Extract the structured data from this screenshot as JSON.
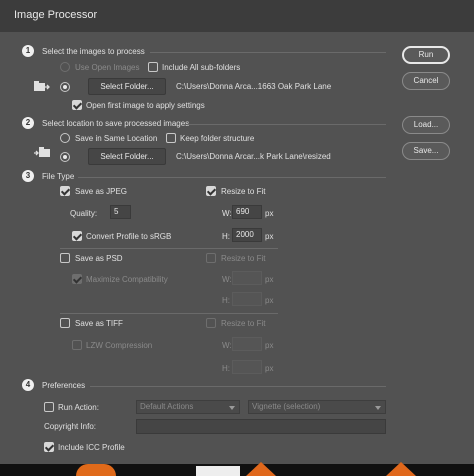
{
  "title": "Image Processor",
  "buttons": {
    "run": "Run",
    "cancel": "Cancel",
    "load": "Load...",
    "save": "Save..."
  },
  "section1": {
    "num": "1",
    "heading": "Select the images to process",
    "use_open_images": "Use Open Images",
    "include_subfolders": "Include All sub-folders",
    "select_folder": "Select Folder...",
    "path": "C:\\Users\\Donna Arca...1663 Oak Park Lane",
    "open_first_image": "Open first image to apply settings"
  },
  "section2": {
    "num": "2",
    "heading": "Select location to save processed images",
    "save_same_location": "Save in Same Location",
    "keep_folder_structure": "Keep folder structure",
    "select_folder": "Select Folder...",
    "path": "C:\\Users\\Donna Arcar...k Park Lane\\resized"
  },
  "section3": {
    "num": "3",
    "heading": "File Type",
    "jpeg": {
      "save_label": "Save as JPEG",
      "resize_label": "Resize to Fit",
      "quality_label": "Quality:",
      "quality_value": "5",
      "w_label": "W:",
      "w_value": "690",
      "w_unit": "px",
      "h_label": "H:",
      "h_value": "2000",
      "h_unit": "px",
      "convert_label": "Convert Profile to sRGB"
    },
    "psd": {
      "save_label": "Save as PSD",
      "resize_label": "Resize to Fit",
      "maximize_label": "Maximize Compatibility",
      "w_label": "W:",
      "w_unit": "px",
      "h_label": "H:",
      "h_unit": "px"
    },
    "tiff": {
      "save_label": "Save as TIFF",
      "resize_label": "Resize to Fit",
      "lzw_label": "LZW Compression",
      "w_label": "W:",
      "w_unit": "px",
      "h_label": "H:",
      "h_unit": "px"
    }
  },
  "section4": {
    "num": "4",
    "heading": "Preferences",
    "run_action": "Run Action:",
    "action_set": "Default Actions",
    "action": "Vignette (selection)",
    "copyright_label": "Copyright Info:",
    "copyright_value": "",
    "include_icc": "Include ICC Profile"
  },
  "checked": {
    "use_open_images": false,
    "include_subfolders": false,
    "open_first_image": true,
    "keep_folder_structure": false,
    "save_jpeg": true,
    "resize_jpeg": true,
    "convert_srgb": true,
    "save_psd": false,
    "resize_psd": false,
    "maximize_compat": true,
    "save_tiff": false,
    "resize_tiff": false,
    "lzw": false,
    "run_action": false,
    "include_icc": true
  },
  "radios": {
    "use_open_images": false,
    "select_folder_source": true,
    "same_location": false,
    "select_folder_dest": true
  }
}
